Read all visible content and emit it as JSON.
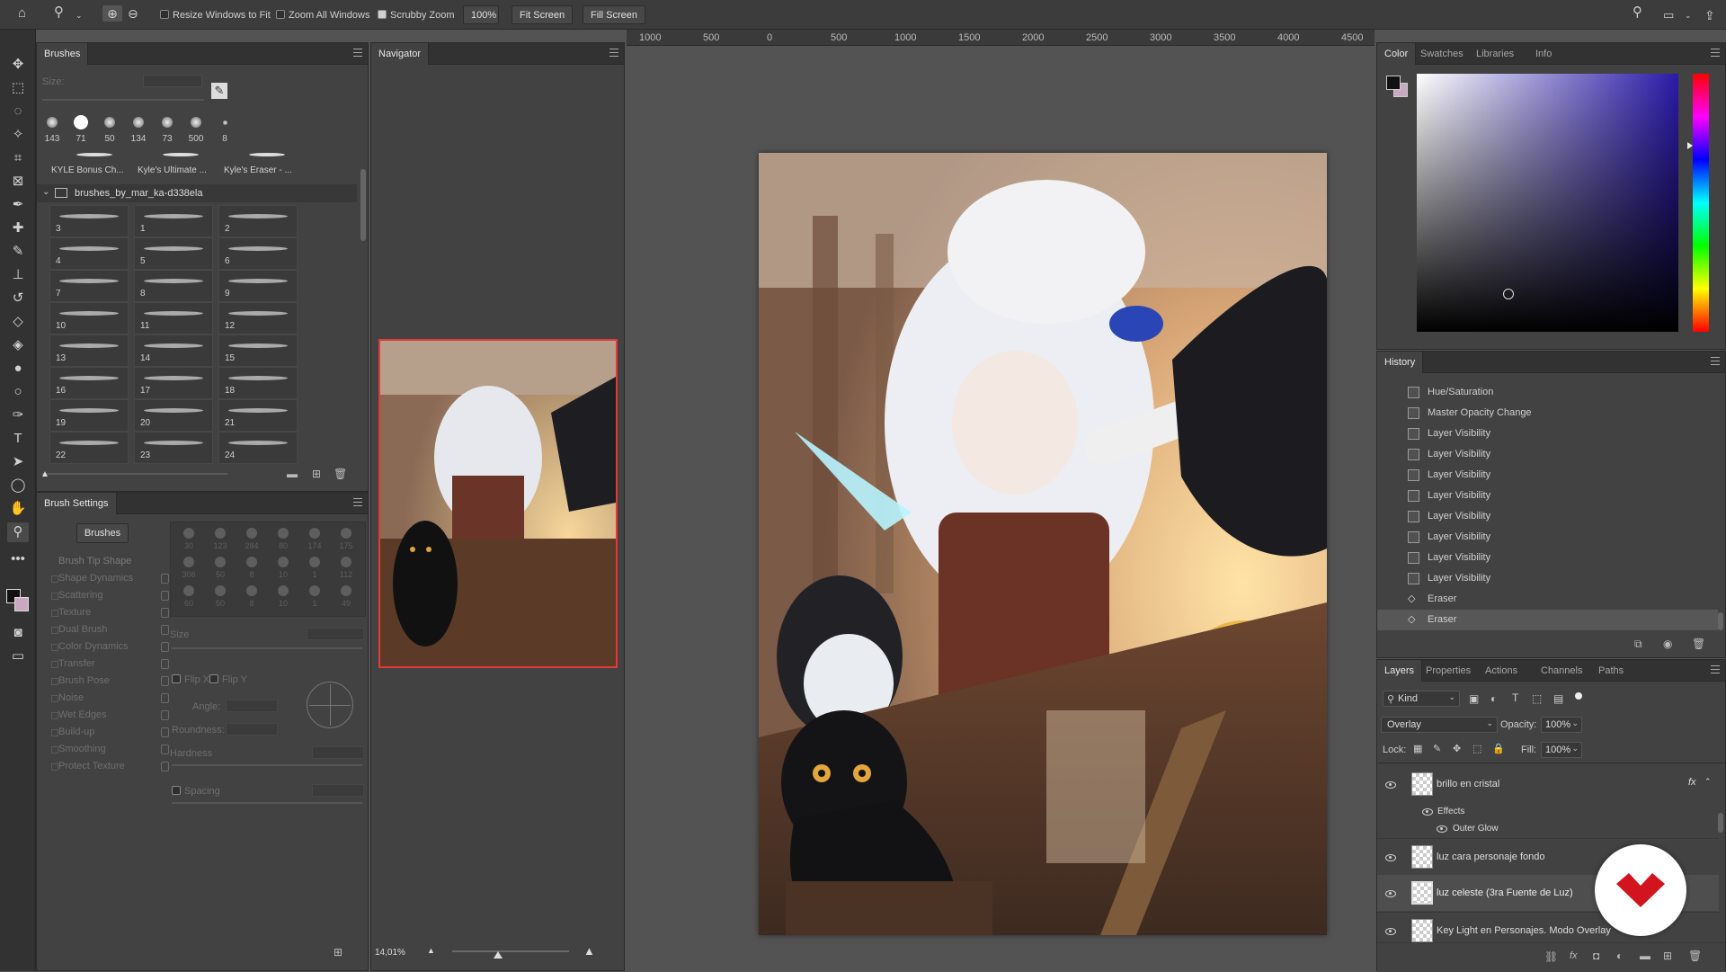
{
  "options_bar": {
    "resize_windows": "Resize Windows to Fit",
    "zoom_all": "Zoom All Windows",
    "scrubby_zoom": "Scrubby Zoom",
    "zoom_value": "100%",
    "fit_screen": "Fit Screen",
    "fill_screen": "Fill Screen"
  },
  "ruler": [
    "1000",
    "500",
    "0",
    "500",
    "1000",
    "1500",
    "2000",
    "2500",
    "3000",
    "3500",
    "4000",
    "4500"
  ],
  "brushes": {
    "tab": "Brushes",
    "size_label": "Size:",
    "presets": [
      "143",
      "71",
      "50",
      "134",
      "73",
      "500",
      "8"
    ],
    "named": [
      "KYLE Bonus Ch...",
      "Kyle's Ultimate ...",
      "Kyle's Eraser - ..."
    ],
    "folder": "brushes_by_mar_ka-d338ela",
    "items": [
      "3",
      "1",
      "2",
      "4",
      "5",
      "6",
      "7",
      "8",
      "9",
      "10",
      "11",
      "12",
      "13",
      "14",
      "15",
      "16",
      "17",
      "18",
      "19",
      "20",
      "21",
      "22",
      "23",
      "24"
    ]
  },
  "brush_settings": {
    "tab": "Brush Settings",
    "brushes_btn": "Brushes",
    "items": [
      "Brush Tip Shape",
      "Shape Dynamics",
      "Scattering",
      "Texture",
      "Dual Brush",
      "Color Dynamics",
      "Transfer",
      "Brush Pose",
      "Noise",
      "Wet Edges",
      "Build-up",
      "Smoothing",
      "Protect Texture"
    ],
    "tip_sizes": [
      "30",
      "123",
      "284",
      "80",
      "174",
      "175",
      "306",
      "50",
      "8",
      "10",
      "1",
      "112",
      "60",
      "50",
      "8",
      "10",
      "1",
      "49"
    ],
    "size": "Size",
    "flip_x": "Flip X",
    "flip_y": "Flip Y",
    "angle": "Angle:",
    "roundness": "Roundness:",
    "hardness": "Hardness",
    "spacing": "Spacing"
  },
  "navigator": {
    "tab": "Navigator",
    "zoom": "14,01%"
  },
  "color_panel": {
    "tabs": [
      "Color",
      "Swatches",
      "Libraries",
      "Info"
    ],
    "hue_color": "#2a1aa8"
  },
  "history": {
    "tab": "History",
    "items": [
      "Hue/Saturation",
      "Master Opacity Change",
      "Layer Visibility",
      "Layer Visibility",
      "Layer Visibility",
      "Layer Visibility",
      "Layer Visibility",
      "Layer Visibility",
      "Layer Visibility",
      "Layer Visibility",
      "Eraser",
      "Eraser"
    ]
  },
  "layers": {
    "tabs": [
      "Layers",
      "Properties",
      "Actions",
      "Channels",
      "Paths"
    ],
    "kind": "Kind",
    "blend_mode": "Overlay",
    "opacity_label": "Opacity:",
    "opacity": "100%",
    "lock_label": "Lock:",
    "fill_label": "Fill:",
    "fill": "100%",
    "items": [
      {
        "name": "brillo en cristal"
      },
      {
        "name": "Effects"
      },
      {
        "name": "Outer Glow"
      },
      {
        "name": "luz cara personaje fondo"
      },
      {
        "name": "luz celeste (3ra Fuente de Luz)"
      },
      {
        "name": "Key Light en Personajes. Modo Overlay"
      }
    ]
  },
  "colors": {
    "accent_nav_frame": "#e03a3a",
    "logo_red": "#d2141e"
  }
}
